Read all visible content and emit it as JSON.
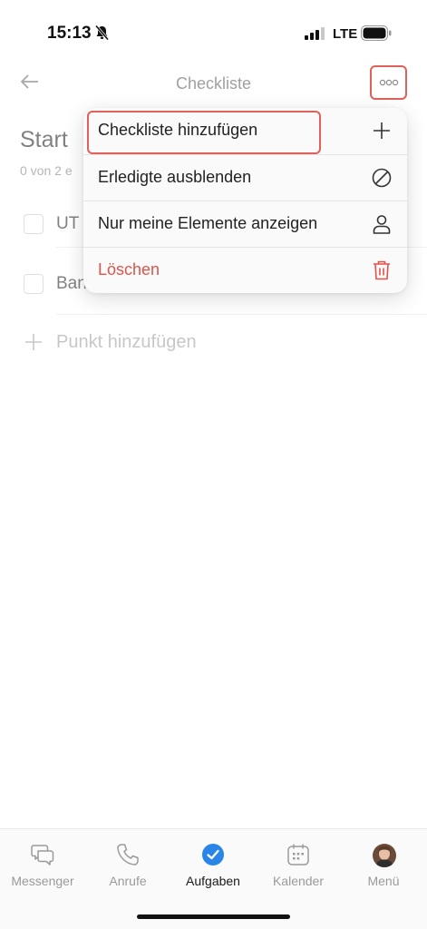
{
  "status_bar": {
    "time": "15:13",
    "network": "LTE"
  },
  "header": {
    "title": "Checkliste",
    "back_icon": "arrow-left-icon",
    "more_icon": "ellipsis-icon"
  },
  "checklist": {
    "title": "Start",
    "progress": "0 von 2 e",
    "items": [
      {
        "label": "UT",
        "checked": false
      },
      {
        "label": "Ban",
        "checked": false
      }
    ],
    "add_item_label": "Punkt hinzufügen"
  },
  "menu": {
    "items": [
      {
        "label": "Checkliste hinzufügen",
        "icon": "plus-icon",
        "highlighted": true
      },
      {
        "label": "Erledigte ausblenden",
        "icon": "hide-icon"
      },
      {
        "label": "Nur meine Elemente anzeigen",
        "icon": "person-icon"
      },
      {
        "label": "Löschen",
        "icon": "trash-icon",
        "danger": true
      }
    ]
  },
  "tab_bar": {
    "tabs": [
      {
        "label": "Messenger",
        "icon": "chat-bubbles-icon"
      },
      {
        "label": "Anrufe",
        "icon": "phone-icon"
      },
      {
        "label": "Aufgaben",
        "icon": "check-circle-icon",
        "active": true
      },
      {
        "label": "Kalender",
        "icon": "calendar-icon"
      },
      {
        "label": "Menü",
        "icon": "avatar"
      }
    ]
  },
  "colors": {
    "accent": "#2a85e8",
    "danger": "#e0534a",
    "highlight": "#e0605a"
  }
}
